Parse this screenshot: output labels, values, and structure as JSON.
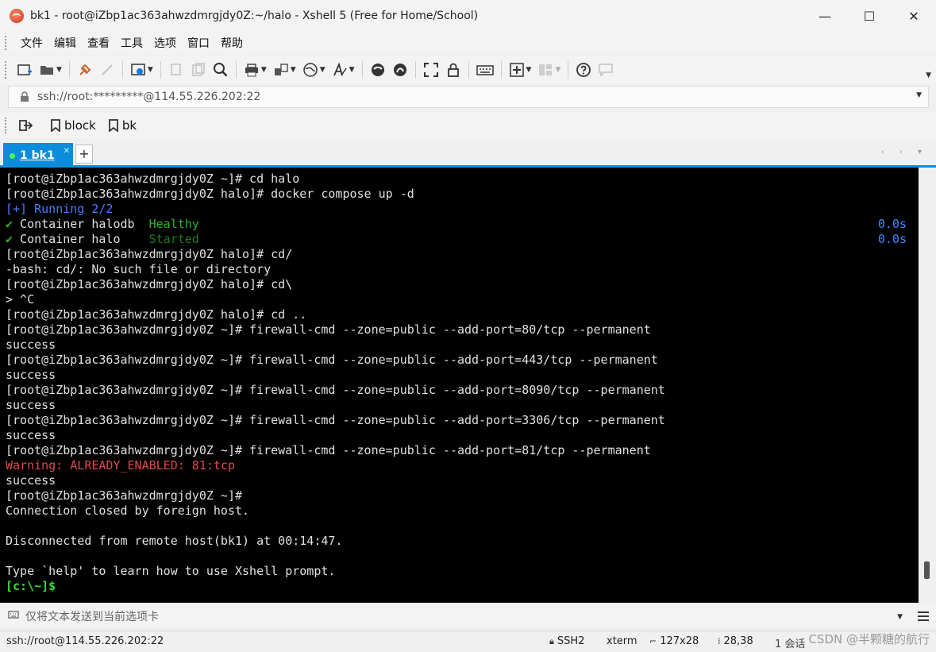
{
  "window": {
    "title": "bk1 - root@iZbp1ac363ahwzdmrgjdy0Z:~/halo - Xshell 5 (Free for Home/School)",
    "minimize": "—",
    "maximize": "☐",
    "close": "✕"
  },
  "menu": [
    "文件",
    "编辑",
    "查看",
    "工具",
    "选项",
    "窗口",
    "帮助"
  ],
  "address": {
    "value": "ssh://root:*********@114.55.226.202:22"
  },
  "links": [
    {
      "label": "block"
    },
    {
      "label": "bk"
    }
  ],
  "tabs": {
    "active_label": "1 bk1",
    "close": "✕",
    "add": "+",
    "nav": "‹ › ▾"
  },
  "terminal": {
    "lines": [
      {
        "text": "[root@iZbp1ac363ahwzdmrgjdy0Z ~]# cd halo"
      },
      {
        "text": "[root@iZbp1ac363ahwzdmrgjdy0Z halo]# docker compose up -d"
      },
      {
        "text": "[+] Running 2/2"
      },
      {
        "check": "✔",
        "text": " Container halodb  ",
        "state": "Healthy",
        "time": "0.0s"
      },
      {
        "check": "✔",
        "text": " Container halo    ",
        "state": "Started",
        "time": "0.0s"
      },
      {
        "text": "[root@iZbp1ac363ahwzdmrgjdy0Z halo]# cd/"
      },
      {
        "text": "-bash: cd/: No such file or directory"
      },
      {
        "text": "[root@iZbp1ac363ahwzdmrgjdy0Z halo]# cd\\"
      },
      {
        "text": "> ^C"
      },
      {
        "text": "[root@iZbp1ac363ahwzdmrgjdy0Z halo]# cd .."
      },
      {
        "text": "[root@iZbp1ac363ahwzdmrgjdy0Z ~]# firewall-cmd --zone=public --add-port=80/tcp --permanent"
      },
      {
        "text": "success"
      },
      {
        "text": "[root@iZbp1ac363ahwzdmrgjdy0Z ~]# firewall-cmd --zone=public --add-port=443/tcp --permanent"
      },
      {
        "text": "success"
      },
      {
        "text": "[root@iZbp1ac363ahwzdmrgjdy0Z ~]# firewall-cmd --zone=public --add-port=8090/tcp --permanent"
      },
      {
        "text": "success"
      },
      {
        "text": "[root@iZbp1ac363ahwzdmrgjdy0Z ~]# firewall-cmd --zone=public --add-port=3306/tcp --permanent"
      },
      {
        "text": "success"
      },
      {
        "text": "[root@iZbp1ac363ahwzdmrgjdy0Z ~]# firewall-cmd --zone=public --add-port=81/tcp --permanent"
      },
      {
        "text": "Warning: ALREADY_ENABLED: 81:tcp"
      },
      {
        "text": "success"
      },
      {
        "text": "[root@iZbp1ac363ahwzdmrgjdy0Z ~]#"
      },
      {
        "text": "Connection closed by foreign host."
      },
      {
        "text": ""
      },
      {
        "text": "Disconnected from remote host(bk1) at 00:14:47."
      },
      {
        "text": ""
      },
      {
        "text": "Type `help' to learn how to use Xshell prompt."
      },
      {
        "text": "[c:\\~]$"
      }
    ]
  },
  "compose": {
    "placeholder": "仅将文本发送到当前选项卡"
  },
  "status": {
    "connection": "ssh://root@114.55.226.202:22",
    "protocol": "SSH2",
    "terminal_type": "xterm",
    "size": "127x28",
    "cursor": "28,38",
    "sessions": "1 会话",
    "watermark": "CSDN @半颗糖的航行"
  },
  "colors": {
    "accent": "#0a8ddb",
    "terminal_bg": "#000000",
    "running": "#4a7cff",
    "healthy": "#2fb52f",
    "warning": "#e04848",
    "prompt": "#2fe02f"
  }
}
